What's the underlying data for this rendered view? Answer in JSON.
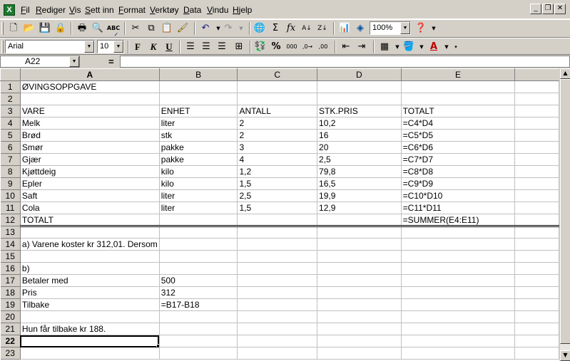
{
  "menubar": {
    "items": [
      {
        "label": "Fil",
        "ul": "F"
      },
      {
        "label": "Rediger",
        "ul": "R"
      },
      {
        "label": "Vis",
        "ul": "V"
      },
      {
        "label": "Sett inn",
        "ul": "S"
      },
      {
        "label": "Format",
        "ul": "F"
      },
      {
        "label": "Verktøy",
        "ul": "V"
      },
      {
        "label": "Data",
        "ul": "D"
      },
      {
        "label": "Vindu",
        "ul": "V"
      },
      {
        "label": "Hjelp",
        "ul": "H"
      }
    ]
  },
  "toolbar": {
    "zoom": "100%",
    "icons": [
      "new-icon",
      "open-icon",
      "save-icon",
      "permission-icon",
      "print-icon",
      "print-preview-icon",
      "spelling-icon",
      "research-icon",
      "cut-icon",
      "copy-icon",
      "paste-icon",
      "format-painter-icon",
      "undo-icon",
      "redo-icon",
      "hyperlink-icon",
      "autosum-icon",
      "function-icon",
      "sort-ascending-icon",
      "sort-descending-icon",
      "chart-wizard-icon",
      "drawing-icon",
      "help-icon"
    ]
  },
  "format_toolbar": {
    "font": "Arial",
    "size": "10",
    "bold_label": "F",
    "italic_label": "K",
    "underline_label": "U"
  },
  "formula_bar": {
    "name_box": "A22",
    "equals": "=",
    "content": ""
  },
  "sheet": {
    "columns": [
      "A",
      "B",
      "C",
      "D",
      "E"
    ],
    "rows": [
      {
        "n": "1",
        "cells": [
          "ØVINGSOPPGAVE",
          "",
          "",
          "",
          ""
        ]
      },
      {
        "n": "2",
        "cells": [
          "",
          "",
          "",
          "",
          ""
        ]
      },
      {
        "n": "3",
        "cells": [
          "VARE",
          "ENHET",
          "ANTALL",
          "STK.PRIS",
          "TOTALT"
        ]
      },
      {
        "n": "4",
        "cells": [
          "Melk",
          "liter",
          "2",
          "10,2",
          "=C4*D4"
        ]
      },
      {
        "n": "5",
        "cells": [
          "Brød",
          "stk",
          "2",
          "16",
          "=C5*D5"
        ]
      },
      {
        "n": "6",
        "cells": [
          "Smør",
          "pakke",
          "3",
          "20",
          "=C6*D6"
        ]
      },
      {
        "n": "7",
        "cells": [
          "Gjær",
          "pakke",
          "4",
          "2,5",
          "=C7*D7"
        ]
      },
      {
        "n": "8",
        "cells": [
          "Kjøttdeig",
          "kilo",
          "1,2",
          "79,8",
          "=C8*D8"
        ]
      },
      {
        "n": "9",
        "cells": [
          "Epler",
          "kilo",
          "1,5",
          "16,5",
          "=C9*D9"
        ]
      },
      {
        "n": "10",
        "cells": [
          "Saft",
          "liter",
          "2,5",
          "19,9",
          "=C10*D10"
        ]
      },
      {
        "n": "11",
        "cells": [
          "Cola",
          "liter",
          "1,5",
          "12,9",
          "=C11*D11"
        ]
      },
      {
        "n": "12",
        "cells": [
          "TOTALT",
          "",
          "",
          "",
          "=SUMMER(E4:E11)"
        ]
      },
      {
        "n": "13",
        "cells": [
          "",
          "",
          "",
          "",
          ""
        ]
      },
      {
        "n": "14",
        "cells": [
          "a) Varene koster kr 312,01. Dersom",
          "",
          "",
          "",
          ""
        ]
      },
      {
        "n": "15",
        "cells": [
          "",
          "",
          "",
          "",
          ""
        ]
      },
      {
        "n": "16",
        "cells": [
          "b)",
          "",
          "",
          "",
          ""
        ]
      },
      {
        "n": "17",
        "cells": [
          "Betaler med",
          "500",
          "",
          "",
          ""
        ]
      },
      {
        "n": "18",
        "cells": [
          "Pris",
          "312",
          "",
          "",
          ""
        ]
      },
      {
        "n": "19",
        "cells": [
          "Tilbake",
          "=B17-B18",
          "",
          "",
          ""
        ]
      },
      {
        "n": "20",
        "cells": [
          "",
          "",
          "",
          "",
          ""
        ]
      },
      {
        "n": "21",
        "cells": [
          "Hun får tilbake kr 188.",
          "",
          "",
          "",
          ""
        ]
      },
      {
        "n": "22",
        "cells": [
          "",
          "",
          "",
          "",
          ""
        ]
      },
      {
        "n": "23",
        "cells": [
          "",
          "",
          "",
          "",
          ""
        ]
      }
    ]
  }
}
